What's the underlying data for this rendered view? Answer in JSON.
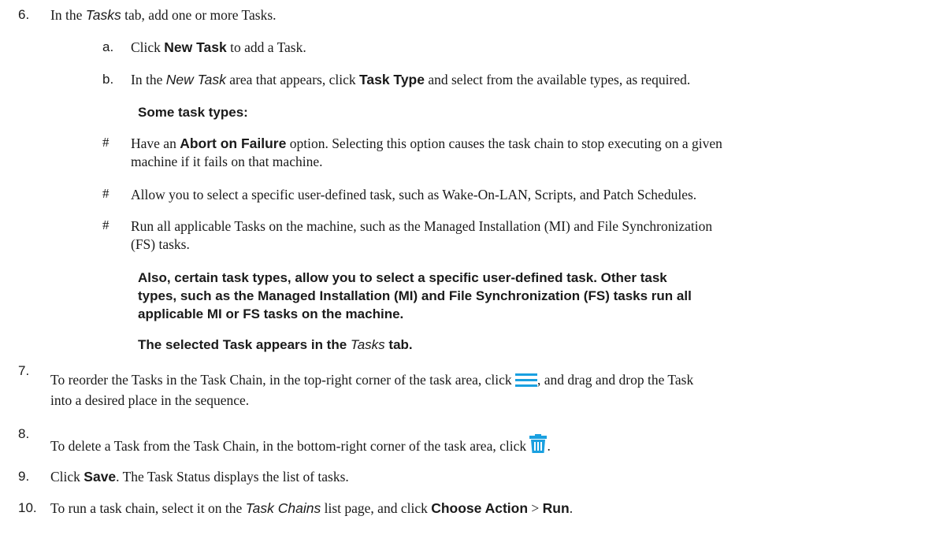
{
  "steps": {
    "s6": {
      "number": "6.",
      "pre": "In the ",
      "tab": "Tasks",
      "post": " tab, add one or more Tasks."
    },
    "s6a": {
      "marker": "a.",
      "pre": "Click ",
      "bold": "New Task",
      "post": " to add a Task."
    },
    "s6b": {
      "marker": "b.",
      "pre": "In the ",
      "ital": "New Task",
      "mid": " area that appears, click ",
      "bold": "Task Type",
      "post": " and select from the available types, as required."
    },
    "some_types_heading": "Some task types:",
    "bullets": [
      {
        "marker": "#",
        "pre": "Have an ",
        "bold": "Abort on Failure",
        "post": " option. Selecting this option causes the task chain to stop executing on a given",
        "line2": "machine if it fails on that machine."
      },
      {
        "marker": "#",
        "text": "Allow you to select a specific user-defined task, such as Wake-On-LAN, Scripts, and Patch Schedules."
      },
      {
        "marker": "#",
        "text": "Run all applicable Tasks on the machine, such as the Managed Installation (MI) and File Synchronization",
        "line2": "(FS) tasks."
      }
    ],
    "note_also": {
      "line1": "Also, certain task types, allow you to select a specific user-defined task. Other task",
      "line2": "types, such as the Managed Installation (MI) and File Synchronization (FS) tasks run all",
      "line3": "applicable MI or FS tasks on the machine."
    },
    "note_selected": {
      "pre": "The selected Task appears in the ",
      "ital": "Tasks",
      "post": " tab."
    },
    "s7": {
      "number": "7.",
      "pre": "To reorder the Tasks in the Task Chain, in the top-right corner of the task area, click ",
      "post": ", and drag and drop the Task",
      "line2": "into a desired place in the sequence.",
      "icon": "menu-icon"
    },
    "s8": {
      "number": "8.",
      "pre": "To delete a Task from the Task Chain, in the bottom-right corner of the task area, click ",
      "post": ".",
      "icon": "trash-icon"
    },
    "s9": {
      "number": "9.",
      "pre": "Click ",
      "bold": "Save",
      "post": ". The Task Status displays the list of tasks."
    },
    "s10": {
      "number": "10.",
      "pre": "To run a task chain, select it on the ",
      "ital": "Task Chains",
      "mid": " list page, and click ",
      "bold1": "Choose Action",
      "sep": " > ",
      "bold2": "Run",
      "post": "."
    }
  },
  "colors": {
    "icon_accent": "#1aa0e0",
    "text": "#1a1a1a"
  }
}
